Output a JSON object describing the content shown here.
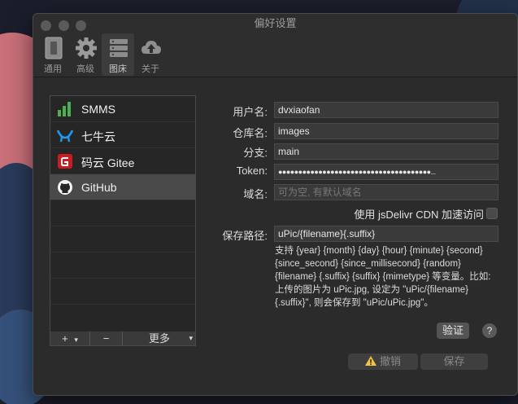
{
  "window": {
    "title": "偏好设置"
  },
  "toolbar": {
    "items": [
      {
        "label": "通用",
        "icon": "general-icon"
      },
      {
        "label": "高级",
        "icon": "gear-icon"
      },
      {
        "label": "图床",
        "icon": "image-host-icon"
      },
      {
        "label": "关于",
        "icon": "cloud-upload-icon"
      }
    ],
    "active_index": 2
  },
  "sidebar": {
    "items": [
      {
        "label": "SMMS",
        "icon": "smms-icon"
      },
      {
        "label": "七牛云",
        "icon": "qiniu-icon"
      },
      {
        "label": "码云 Gitee",
        "icon": "gitee-icon"
      },
      {
        "label": "GitHub",
        "icon": "github-icon"
      }
    ],
    "selected_index": 3,
    "footer": {
      "add": "+",
      "remove": "−",
      "more": "更多"
    }
  },
  "form": {
    "username_label": "用户名:",
    "username_value": "dvxiaofan",
    "repo_label": "仓库名:",
    "repo_value": "images",
    "branch_label": "分支:",
    "branch_value": "main",
    "token_label": "Token:",
    "token_value": "●●●●●●●●●●●●●●●●●●●●●●●●●●●●●●●●●●●●●●...",
    "domain_label": "域名:",
    "domain_placeholder": "可为空, 有默认域名",
    "jsdelivr_label": "使用 jsDelivr CDN 加速访问",
    "path_label": "保存路径:",
    "path_value": "uPic/{filename}{.suffix}",
    "path_help": "支持 {year} {month} {day} {hour} {minute} {second} {since_second} {since_millisecond} {random} {filename} {.suffix} {suffix} {mimetype} 等变量。比如: 上传的图片为 uPic.jpg, 设定为 \"uPic/{filename}{.suffix}\", 则会保存到 \"uPic/uPic.jpg\"。"
  },
  "buttons": {
    "verify": "验证",
    "help": "?",
    "cancel": "撤销",
    "save": "保存"
  },
  "colors": {
    "smms_green": "#4caf50",
    "qiniu_blue": "#1e9bf0",
    "gitee_red": "#c71d23",
    "warning_yellow": "#f5c542"
  }
}
